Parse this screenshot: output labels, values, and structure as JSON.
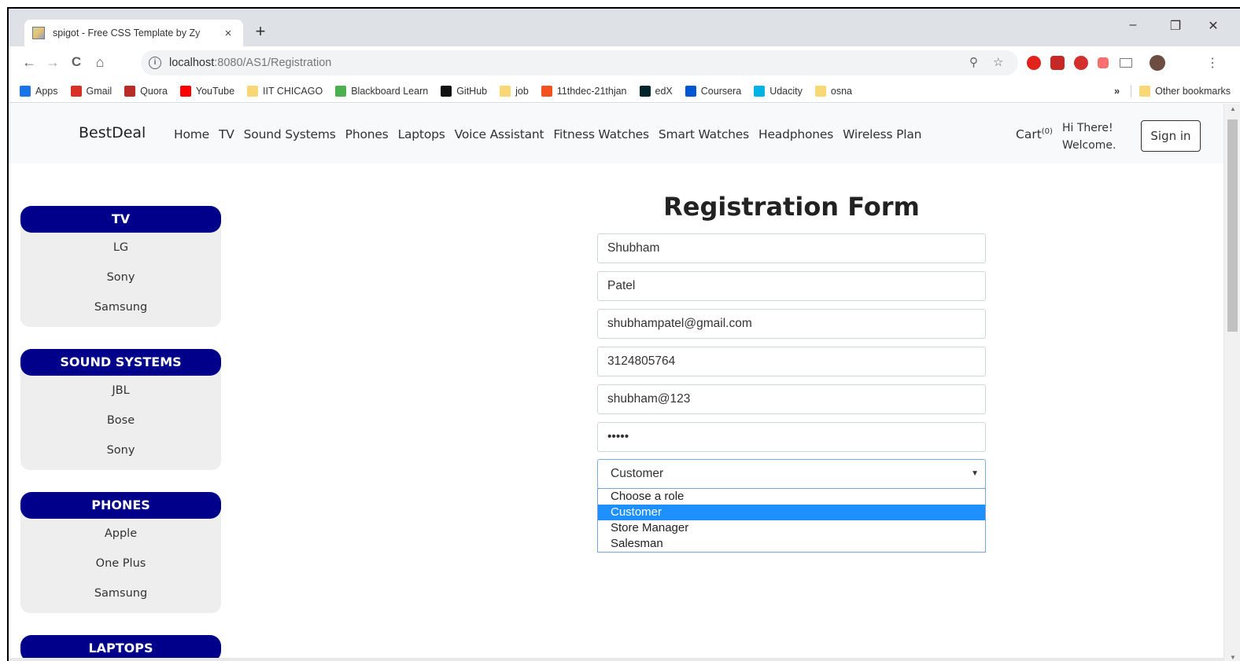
{
  "browser": {
    "tab_title": "spigot - Free CSS Template by Zy",
    "tab_close": "×",
    "new_tab": "+",
    "url_host": "localhost",
    "url_rest": ":8080/AS1/Registration",
    "controls": {
      "minimize": "–",
      "restore": "❐",
      "close": "✕"
    },
    "nav": {
      "back": "←",
      "forward": "→",
      "reload": "C",
      "home": "⌂"
    },
    "bookmarks": [
      {
        "label": "Apps",
        "icon": "apps-grid-icon",
        "color": "#1a73e8"
      },
      {
        "label": "Gmail",
        "icon": "gmail-icon",
        "color": "#d93025"
      },
      {
        "label": "Quora",
        "icon": "quora-icon",
        "color": "#b92b27"
      },
      {
        "label": "YouTube",
        "icon": "youtube-icon",
        "color": "#ff0000"
      },
      {
        "label": "IIT CHICAGO",
        "icon": "folder-icon",
        "color": "#f8d775"
      },
      {
        "label": "Blackboard Learn",
        "icon": "blackboard-icon",
        "color": "#4caf50"
      },
      {
        "label": "GitHub",
        "icon": "github-icon",
        "color": "#111111"
      },
      {
        "label": "job",
        "icon": "folder-icon",
        "color": "#f8d775"
      },
      {
        "label": "11thdec-21thjan",
        "icon": "go-icon",
        "color": "#f4511e"
      },
      {
        "label": "edX",
        "icon": "edx-icon",
        "color": "#02262b"
      },
      {
        "label": "Coursera",
        "icon": "coursera-icon",
        "color": "#0056d2"
      },
      {
        "label": "Udacity",
        "icon": "udacity-icon",
        "color": "#02b3e4"
      },
      {
        "label": "osna",
        "icon": "folder-icon",
        "color": "#f8d775"
      }
    ],
    "more_bookmarks": "»",
    "other_bookmarks": "Other bookmarks"
  },
  "site": {
    "brand": "BestDeal",
    "nav_links": [
      "Home",
      "TV",
      "Sound Systems",
      "Phones",
      "Laptops",
      "Voice Assistant",
      "Fitness Watches",
      "Smart Watches",
      "Headphones",
      "Wireless Plan"
    ],
    "cart_label": "Cart",
    "cart_count": "(0)",
    "greeting_line1": "Hi There!",
    "greeting_line2": "Welcome.",
    "signin_label": "Sign in",
    "brand_color": "#00008b"
  },
  "sidebar": {
    "categories": [
      {
        "title": "TV",
        "items": [
          "LG",
          "Sony",
          "Samsung"
        ]
      },
      {
        "title": "SOUND SYSTEMS",
        "items": [
          "JBL",
          "Bose",
          "Sony"
        ]
      },
      {
        "title": "PHONES",
        "items": [
          "Apple",
          "One Plus",
          "Samsung"
        ]
      },
      {
        "title": "LAPTOPS",
        "items": []
      }
    ]
  },
  "form": {
    "title": "Registration Form",
    "first_name": "Shubham",
    "last_name": "Patel",
    "email": "shubhampatel@gmail.com",
    "phone": "3124805764",
    "username": "shubham@123",
    "password": "•••••",
    "role_selected": "Customer",
    "caret": "▼",
    "role_options": [
      "Choose a role",
      "Customer",
      "Store Manager",
      "Salesman"
    ],
    "highlight_color": "#1e90ff"
  }
}
